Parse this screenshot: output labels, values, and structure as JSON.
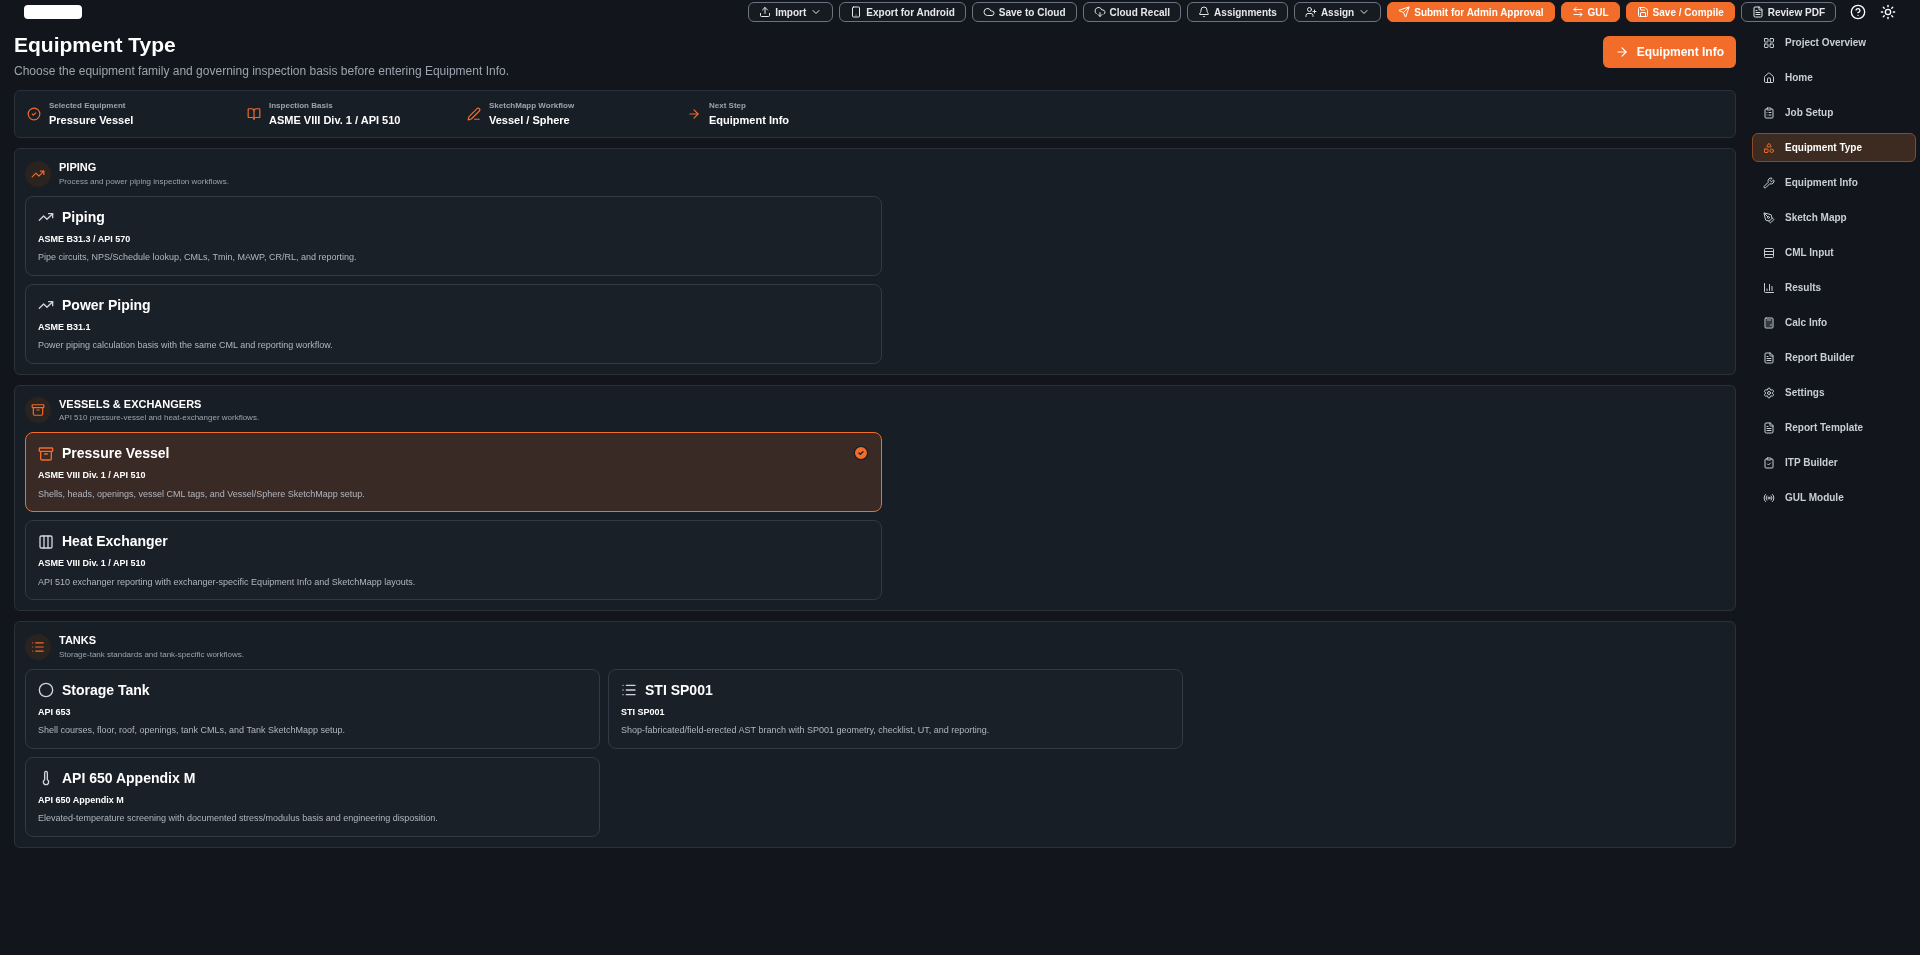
{
  "toolbar": {
    "buttons": [
      {
        "label": "Import",
        "kind": "outline",
        "caret": true
      },
      {
        "label": "Export for Android",
        "kind": "outline",
        "caret": false
      },
      {
        "label": "Save to Cloud",
        "kind": "outline",
        "caret": false
      },
      {
        "label": "Cloud Recall",
        "kind": "outline",
        "caret": false
      },
      {
        "label": "Assignments",
        "kind": "outline",
        "caret": false
      },
      {
        "label": "Assign",
        "kind": "outline",
        "caret": true
      },
      {
        "label": "Submit for Admin Approval",
        "kind": "primary",
        "caret": false
      },
      {
        "label": "GUL",
        "kind": "primary",
        "caret": false
      },
      {
        "label": "Save / Compile",
        "kind": "primary",
        "caret": false
      },
      {
        "label": "Review PDF",
        "kind": "outline",
        "caret": false
      }
    ]
  },
  "page": {
    "title": "Equipment Type",
    "subtitle": "Choose the equipment family and governing inspection basis before entering Equipment Info.",
    "action": "Equipment Info"
  },
  "summary": [
    {
      "label": "Selected Equipment",
      "value": "Pressure Vessel"
    },
    {
      "label": "Inspection Basis",
      "value": "ASME VIII Div. 1 / API 510"
    },
    {
      "label": "SketchMapp Workflow",
      "value": "Vessel / Sphere"
    },
    {
      "label": "Next Step",
      "value": "Equipment Info"
    }
  ],
  "sections": [
    {
      "title": "PIPING",
      "description": "Process and power piping inspection workflows.",
      "kind": "list",
      "cards": [
        {
          "title": "Piping",
          "basis": "ASME B31.3 / API 570",
          "description": "Pipe circuits, NPS/Schedule lookup, CMLs, Tmin, MAWP, CR/RL, and reporting.",
          "selected": false
        },
        {
          "title": "Power Piping",
          "basis": "ASME B31.1",
          "description": "Power piping calculation basis with the same CML and reporting workflow.",
          "selected": false
        }
      ]
    },
    {
      "title": "VESSELS & EXCHANGERS",
      "description": "API 510 pressure-vessel and heat-exchanger workflows.",
      "kind": "list",
      "cards": [
        {
          "title": "Pressure Vessel",
          "basis": "ASME VIII Div. 1 / API 510",
          "description": "Shells, heads, openings, vessel CML tags, and Vessel/Sphere SketchMapp setup.",
          "selected": true
        },
        {
          "title": "Heat Exchanger",
          "basis": "ASME VIII Div. 1 / API 510",
          "description": "API 510 exchanger reporting with exchanger-specific Equipment Info and SketchMapp layouts.",
          "selected": false
        }
      ]
    },
    {
      "title": "TANKS",
      "description": "Storage-tank standards and tank-specific workflows.",
      "kind": "grid",
      "cards": [
        {
          "title": "Storage Tank",
          "basis": "API 653",
          "description": "Shell courses, floor, roof, openings, tank CMLs, and Tank SketchMapp setup.",
          "selected": false
        },
        {
          "title": "STI SP001",
          "basis": "STI SP001",
          "description": "Shop-fabricated/field-erected AST branch with SP001 geometry, checklist, UT, and reporting.",
          "selected": false
        },
        {
          "title": "API 650 Appendix M",
          "basis": "API 650 Appendix M",
          "description": "Elevated-temperature screening with documented stress/modulus basis and engineering disposition.",
          "selected": false
        }
      ]
    }
  ],
  "sidebar": {
    "items": [
      {
        "label": "Project Overview",
        "selected": false
      },
      {
        "label": "Home",
        "selected": false
      },
      {
        "label": "Job Setup",
        "selected": false
      },
      {
        "label": "Equipment Type",
        "selected": true
      },
      {
        "label": "Equipment Info",
        "selected": false
      },
      {
        "label": "Sketch Mapp",
        "selected": false
      },
      {
        "label": "CML Input",
        "selected": false
      },
      {
        "label": "Results",
        "selected": false
      },
      {
        "label": "Calc Info",
        "selected": false
      },
      {
        "label": "Report Builder",
        "selected": false
      },
      {
        "label": "Settings",
        "selected": false
      },
      {
        "label": "Report Template",
        "selected": false
      },
      {
        "label": "ITP Builder",
        "selected": false
      },
      {
        "label": "GUL Module",
        "selected": false
      }
    ]
  }
}
